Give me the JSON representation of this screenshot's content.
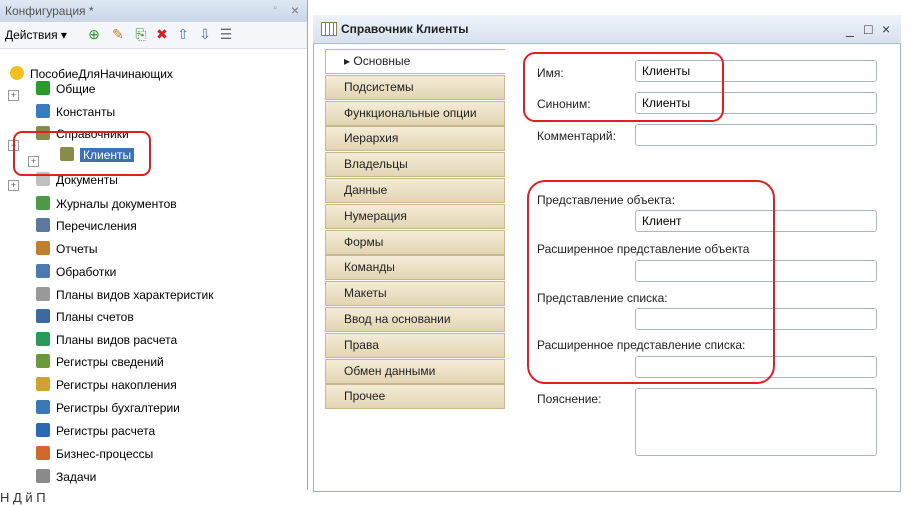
{
  "left_panel": {
    "title": "Конфигурация *",
    "close": "×",
    "pin": "▫",
    "actions_label": "Действия ▾",
    "root": "ПособиеДляНачинающих",
    "items": [
      {
        "label": "Общие",
        "icon": "people-icon",
        "color": "#2a9a2a"
      },
      {
        "label": "Константы",
        "icon": "constants-icon",
        "color": "#3a7ac0"
      },
      {
        "label": "Справочники",
        "icon": "catalog-icon",
        "color": "#8a8a4a"
      },
      {
        "label": "Клиенты",
        "icon": "catalog-icon",
        "color": "#8a8a4a"
      },
      {
        "label": "Документы",
        "icon": "document-icon",
        "color": "#c0c0c0"
      },
      {
        "label": "Журналы документов",
        "icon": "journal-icon",
        "color": "#4a9a4a"
      },
      {
        "label": "Перечисления",
        "icon": "enum-icon",
        "color": "#5a7aa0"
      },
      {
        "label": "Отчеты",
        "icon": "report-icon",
        "color": "#c08030"
      },
      {
        "label": "Обработки",
        "icon": "processing-icon",
        "color": "#4a7ab0"
      },
      {
        "label": "Планы видов характеристик",
        "icon": "char-plan-icon",
        "color": "#999999"
      },
      {
        "label": "Планы счетов",
        "icon": "accounts-plan-icon",
        "color": "#3a6aa0"
      },
      {
        "label": "Планы видов расчета",
        "icon": "calc-plan-icon",
        "color": "#2a9a5a"
      },
      {
        "label": "Регистры сведений",
        "icon": "info-register-icon",
        "color": "#6a9a3a"
      },
      {
        "label": "Регистры накопления",
        "icon": "accum-register-icon",
        "color": "#d0a030"
      },
      {
        "label": "Регистры бухгалтерии",
        "icon": "account-register-icon",
        "color": "#3a7ab0"
      },
      {
        "label": "Регистры расчета",
        "icon": "calc-register-icon",
        "color": "#2a6ab0"
      },
      {
        "label": "Бизнес-процессы",
        "icon": "bizproc-icon",
        "color": "#d06a2a"
      },
      {
        "label": "Задачи",
        "icon": "task-icon",
        "color": "#8a8a8a"
      }
    ]
  },
  "right_panel": {
    "title": "Справочник Клиенты",
    "minimize": "_",
    "maximize": "□",
    "close": "×",
    "tabs": [
      "▸ Основные",
      "Подсистемы",
      "Функциональные опции",
      "Иерархия",
      "Владельцы",
      "Данные",
      "Нумерация",
      "Формы",
      "Команды",
      "Макеты",
      "Ввод на основании",
      "Права",
      "Обмен данными",
      "Прочее"
    ],
    "fields": {
      "name_label": "Имя:",
      "name_value": "Клиенты",
      "synonym_label": "Синоним:",
      "synonym_value": "Клиенты",
      "comment_label": "Комментарий:",
      "comment_value": "",
      "obj_repr_label": "Представление объекта:",
      "obj_repr_value": "Клиент",
      "ext_obj_repr_label": "Расширенное представление объекта",
      "ext_obj_repr_value": "",
      "list_repr_label": "Представление списка:",
      "list_repr_value": "",
      "ext_list_repr_label": "Расширенное представление списка:",
      "ext_list_repr_value": "",
      "explanation_label": "Пояснение:",
      "explanation_value": ""
    }
  },
  "caption": "Н                    Д                    й                    П"
}
